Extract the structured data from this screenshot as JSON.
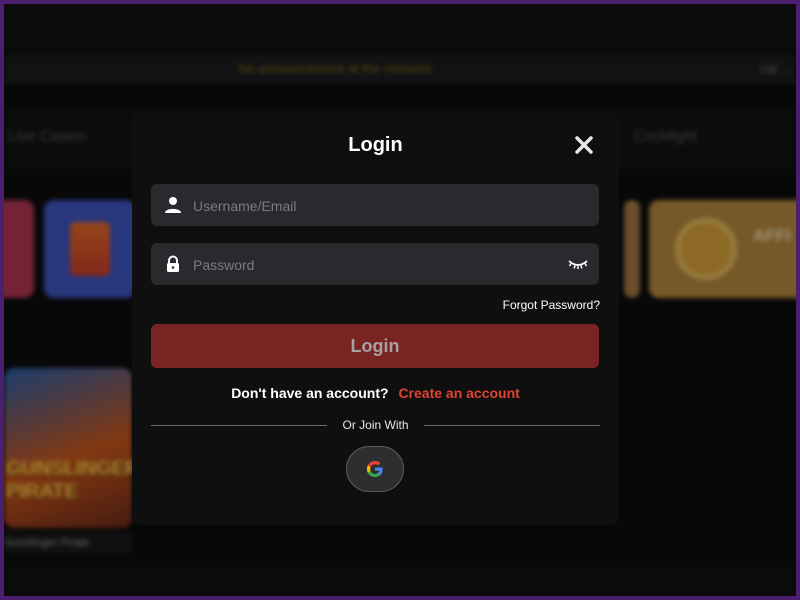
{
  "background": {
    "announcement": "No announcement at the moment",
    "announcement_right": "ca/ ...",
    "nav_left": "Live Casino",
    "nav_right": "Cockfight",
    "promo_tile_text": "AFFI",
    "game_tile_art_text": "GUNSLINGER PIRATE",
    "game_caption": "Gunslinger Pirate"
  },
  "modal": {
    "title": "Login",
    "username_placeholder": "Username/Email",
    "password_placeholder": "Password",
    "forgot_label": "Forgot Password?",
    "login_button_label": "Login",
    "no_account_text": "Don't have an account?",
    "create_account_label": "Create an account",
    "or_join_text": "Or Join With"
  },
  "icons": {
    "close": "close-icon",
    "user": "user-icon",
    "lock": "lock-icon",
    "eye": "eye-closed-icon",
    "google": "google-icon"
  },
  "colors": {
    "modal_bg": "#0f0f10",
    "field_bg": "#2a2a2e",
    "login_button": "#7a2323",
    "link_accent": "#e0442f",
    "frame_border": "#4a1f6e"
  }
}
